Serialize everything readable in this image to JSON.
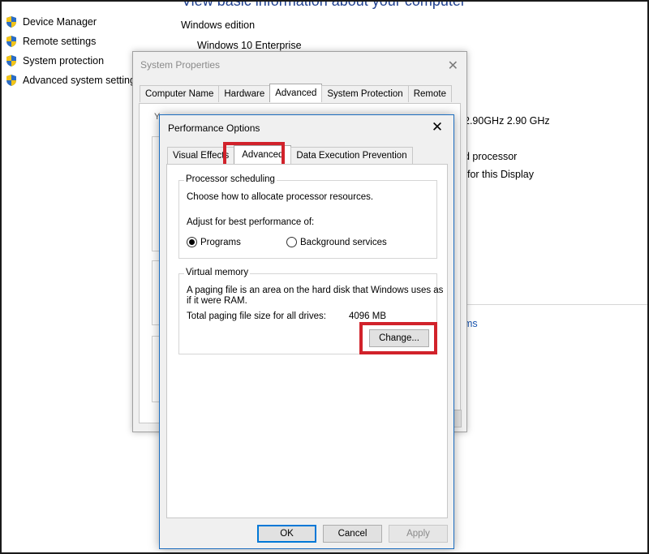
{
  "background": {
    "heading": "View basic information about your computer",
    "edition_label": "Windows edition",
    "edition_value": "Windows 10 Enterprise",
    "cpu_speed": "2.90GHz  2.90 GHz",
    "processor_fragment": "d processor",
    "display_fragment": "for this Display",
    "link_fragment": "ms",
    "sidebar": [
      {
        "label": "Device Manager",
        "icon": "shield-icon"
      },
      {
        "label": "Remote settings",
        "icon": "shield-icon"
      },
      {
        "label": "System protection",
        "icon": "shield-icon"
      },
      {
        "label": "Advanced system settings",
        "icon": "shield-icon"
      }
    ]
  },
  "system_properties": {
    "title": "System Properties",
    "tabs": [
      "Computer Name",
      "Hardware",
      "Advanced",
      "System Protection",
      "Remote"
    ],
    "active_tab": "Advanced",
    "hint_fragment": "Y"
  },
  "performance_options": {
    "title": "Performance Options",
    "tabs": [
      "Visual Effects",
      "Advanced",
      "Data Execution Prevention"
    ],
    "active_tab": "Advanced",
    "processor_scheduling": {
      "legend": "Processor scheduling",
      "description": "Choose how to allocate processor resources.",
      "adjust_label": "Adjust for best performance of:",
      "options": [
        {
          "label": "Programs",
          "selected": true
        },
        {
          "label": "Background services",
          "selected": false
        }
      ]
    },
    "virtual_memory": {
      "legend": "Virtual memory",
      "description_line1": "A paging file is an area on the hard disk that Windows uses as",
      "description_line2": "if it were RAM.",
      "total_label": "Total paging file size for all drives:",
      "total_value": "4096 MB",
      "change_button": "Change..."
    },
    "buttons": {
      "ok": "OK",
      "cancel": "Cancel",
      "apply": "Apply"
    }
  },
  "colors": {
    "highlight": "#d1222b",
    "accent": "#0078d7",
    "link": "#1a56b0"
  }
}
